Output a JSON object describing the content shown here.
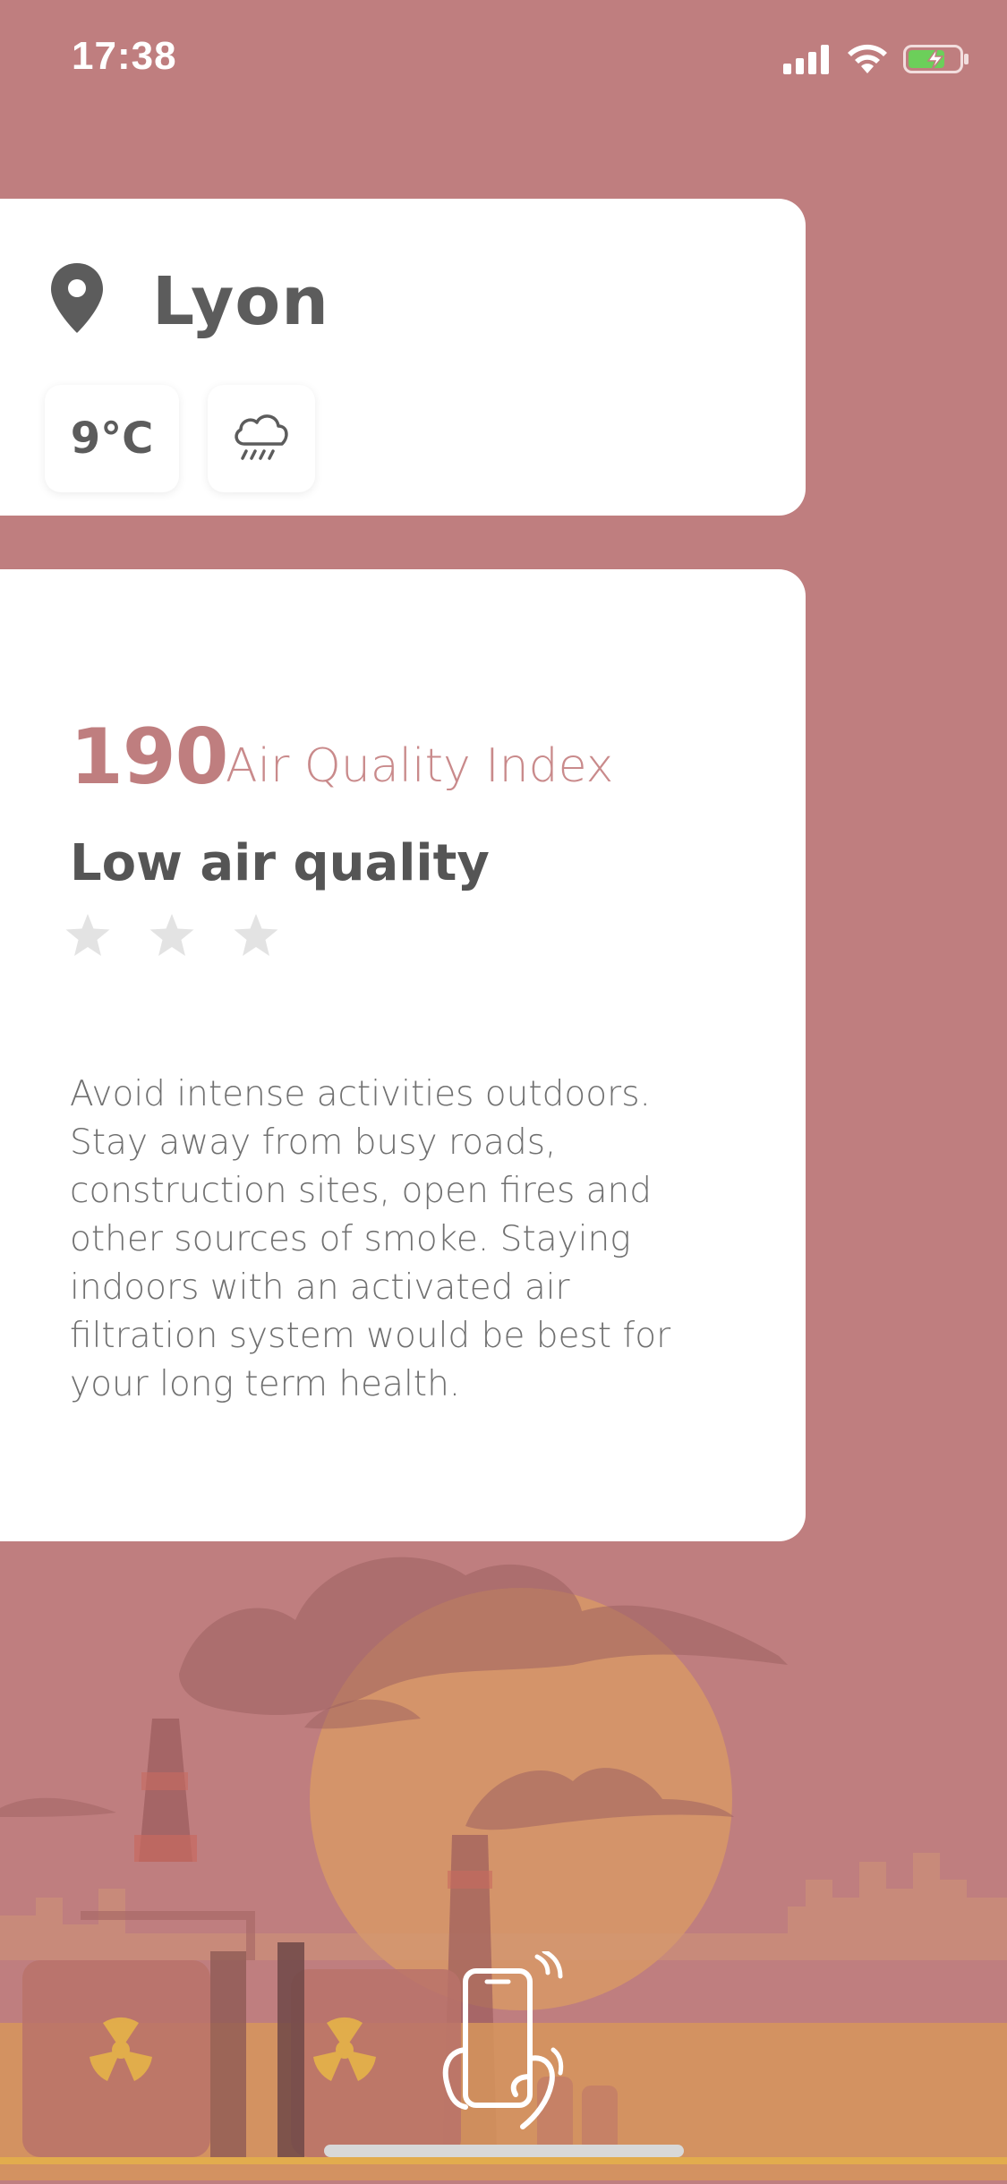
{
  "status_bar": {
    "time": "17:38",
    "signal_icon": "cellular-signal-icon",
    "wifi_icon": "wifi-icon",
    "battery_icon": "battery-charging-icon"
  },
  "location": {
    "icon": "location-pin-icon",
    "city": "Lyon",
    "temperature": "9°C",
    "weather_icon": "rain-cloud-icon"
  },
  "air_quality": {
    "index_value": "190",
    "index_label": "Air Quality Index",
    "title": "Low air quality",
    "rating_filled": 0,
    "rating_total": 3,
    "description": "Avoid intense activities outdoors. Stay away from busy roads, construction sites, open fires and other sources of smoke. Staying indoors with an activated air filtration system would be best for your long term health."
  },
  "footer": {
    "shake_icon": "shake-phone-icon"
  },
  "colors": {
    "background": "#bf7e7f",
    "accent": "#bf7e7f",
    "card": "#ffffff",
    "text_dark": "#5c5c5c",
    "sun": "#e6a55a"
  }
}
